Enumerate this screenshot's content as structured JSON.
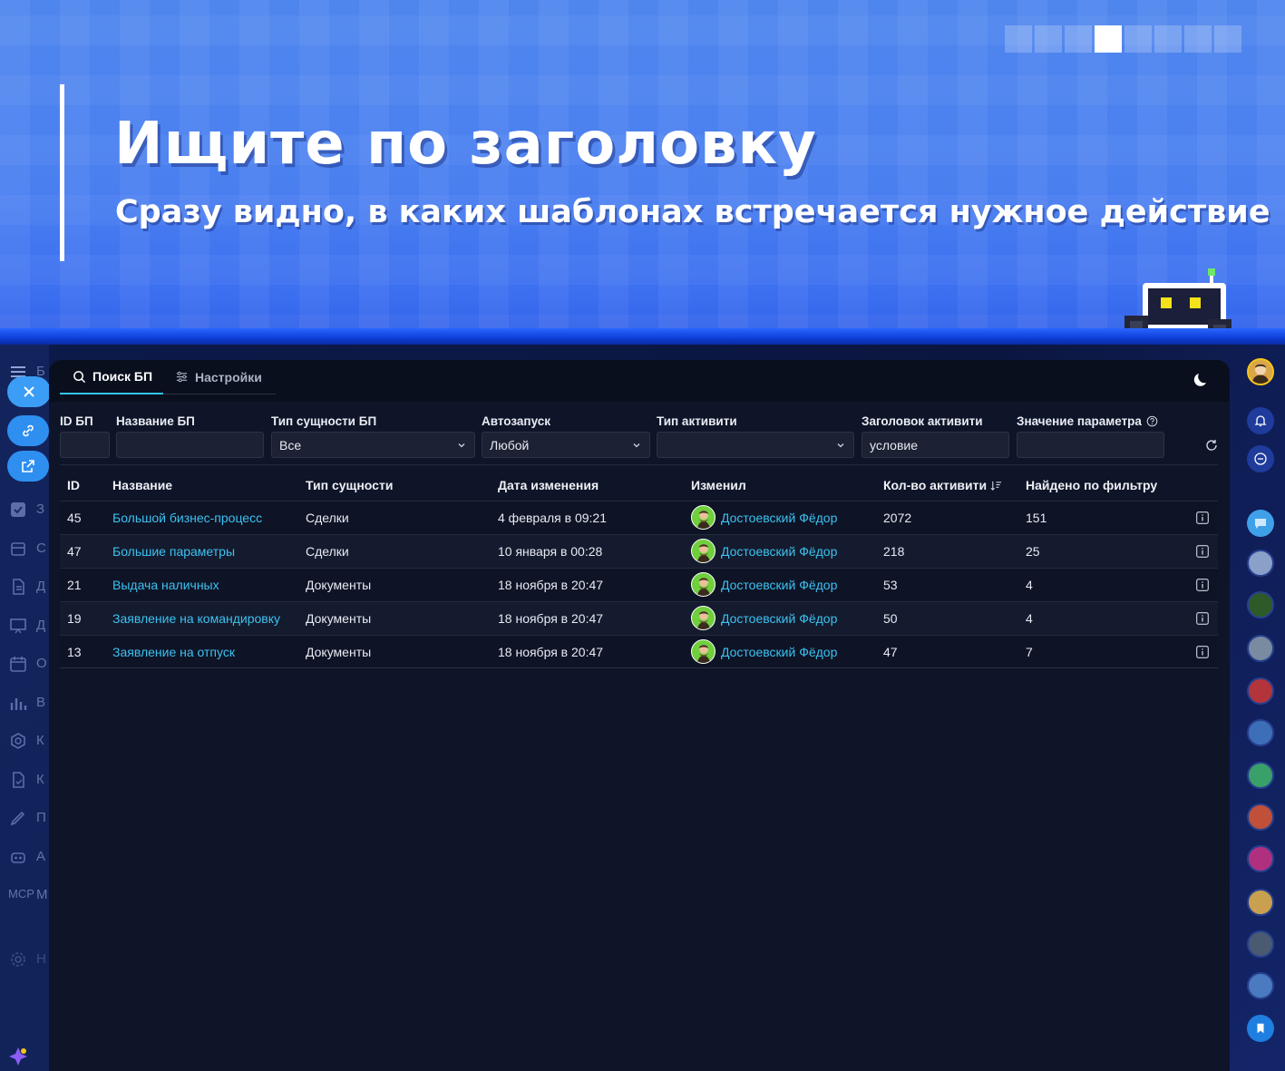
{
  "banner": {
    "title": "Ищите по заголовку",
    "subtitle": "Сразу видно, в каких шаблонах встречается нужное действие",
    "slides": 8,
    "active_slide": 4
  },
  "tabs": [
    {
      "label": "Поиск БП",
      "icon": "search-icon",
      "active": true
    },
    {
      "label": "Настройки",
      "icon": "sliders-icon",
      "active": false
    }
  ],
  "filters": {
    "id_bp": {
      "label": "ID БП",
      "value": ""
    },
    "name_bp": {
      "label": "Название БП",
      "value": ""
    },
    "entity_type": {
      "label": "Тип сущности БП",
      "value": "Все"
    },
    "autostart": {
      "label": "Автозапуск",
      "value": "Любой"
    },
    "activity_type": {
      "label": "Тип активити",
      "value": ""
    },
    "activity_title": {
      "label": "Заголовок активити",
      "value": "условие"
    },
    "param_value": {
      "label": "Значение параметра",
      "value": ""
    }
  },
  "table": {
    "headers": {
      "id": "ID",
      "name": "Название",
      "entity": "Тип сущности",
      "date": "Дата изменения",
      "user": "Изменил",
      "count": "Кол-во активити",
      "found": "Найдено по фильтру"
    },
    "rows": [
      {
        "id": "45",
        "name": "Большой бизнес-процесс",
        "entity": "Сделки",
        "date": "4 февраля в 09:21",
        "user": "Достоевский Фёдор",
        "count": "2072",
        "found": "151"
      },
      {
        "id": "47",
        "name": "Большие параметры",
        "entity": "Сделки",
        "date": "10 января в 00:28",
        "user": "Достоевский Фёдор",
        "count": "218",
        "found": "25"
      },
      {
        "id": "21",
        "name": "Выдача наличных",
        "entity": "Документы",
        "date": "18 ноября в 20:47",
        "user": "Достоевский Фёдор",
        "count": "53",
        "found": "4"
      },
      {
        "id": "19",
        "name": "Заявление на командировку",
        "entity": "Документы",
        "date": "18 ноября в 20:47",
        "user": "Достоевский Фёдор",
        "count": "50",
        "found": "4"
      },
      {
        "id": "13",
        "name": "Заявление на отпуск",
        "entity": "Документы",
        "date": "18 ноября в 20:47",
        "user": "Достоевский Фёдор",
        "count": "47",
        "found": "7"
      }
    ]
  },
  "left_sidebar": {
    "letters": [
      "Б",
      "З",
      "С",
      "Д",
      "Д",
      "О",
      "В",
      "К",
      "К",
      "П",
      "А",
      "М",
      "Н"
    ],
    "mcp_label": "MCP"
  },
  "colors": {
    "accent": "#3cc1f0",
    "panel_bg": "#0e1528",
    "banner_blue": "#4a7ff0"
  }
}
